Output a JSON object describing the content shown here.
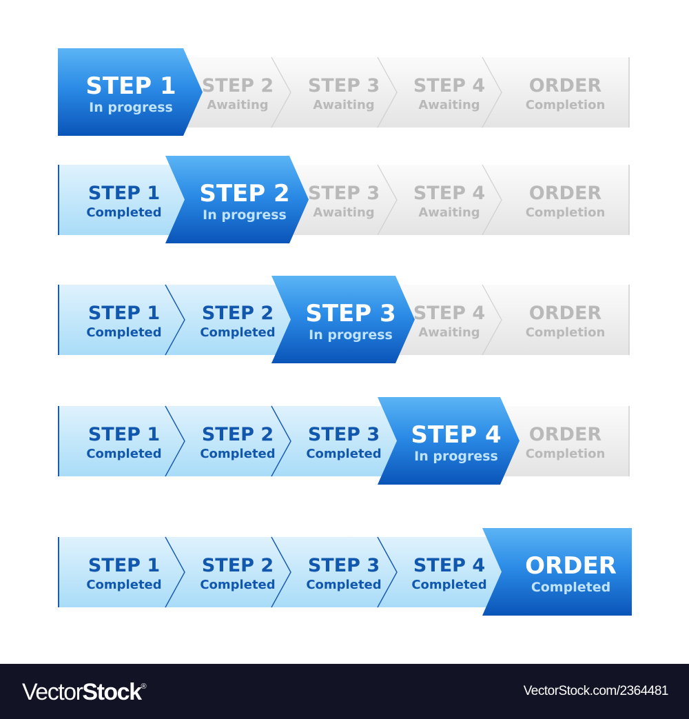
{
  "colors": {
    "active_top": "#5bb4f4",
    "active_mid": "#2b8be6",
    "active_bottom": "#0a54b8",
    "active_title": "#ffffff",
    "active_sub": "#bfe3fb",
    "done_top": "#dff2fd",
    "done_bottom": "#a9dcf8",
    "done_text": "#1057ad",
    "done_line": "#1a5cb0",
    "pending_top": "#fbfbfb",
    "pending_bottom": "#e4e4e4",
    "pending_text": "#b9b9b9",
    "pending_line": "#cfcfcf"
  },
  "rows": [
    {
      "steps": [
        {
          "title": "STEP 1",
          "status": "In progress",
          "state": "active"
        },
        {
          "title": "STEP 2",
          "status": "Awaiting",
          "state": "pending"
        },
        {
          "title": "STEP 3",
          "status": "Awaiting",
          "state": "pending"
        },
        {
          "title": "STEP 4",
          "status": "Awaiting",
          "state": "pending"
        },
        {
          "title": "ORDER",
          "status": "Completion",
          "state": "pending"
        }
      ]
    },
    {
      "steps": [
        {
          "title": "STEP 1",
          "status": "Completed",
          "state": "done"
        },
        {
          "title": "STEP 2",
          "status": "In progress",
          "state": "active"
        },
        {
          "title": "STEP 3",
          "status": "Awaiting",
          "state": "pending"
        },
        {
          "title": "STEP 4",
          "status": "Awaiting",
          "state": "pending"
        },
        {
          "title": "ORDER",
          "status": "Completion",
          "state": "pending"
        }
      ]
    },
    {
      "steps": [
        {
          "title": "STEP 1",
          "status": "Completed",
          "state": "done"
        },
        {
          "title": "STEP 2",
          "status": "Completed",
          "state": "done"
        },
        {
          "title": "STEP 3",
          "status": "In progress",
          "state": "active"
        },
        {
          "title": "STEP 4",
          "status": "Awaiting",
          "state": "pending"
        },
        {
          "title": "ORDER",
          "status": "Completion",
          "state": "pending"
        }
      ]
    },
    {
      "steps": [
        {
          "title": "STEP 1",
          "status": "Completed",
          "state": "done"
        },
        {
          "title": "STEP 2",
          "status": "Completed",
          "state": "done"
        },
        {
          "title": "STEP 3",
          "status": "Completed",
          "state": "done"
        },
        {
          "title": "STEP 4",
          "status": "In progress",
          "state": "active"
        },
        {
          "title": "ORDER",
          "status": "Completion",
          "state": "pending"
        }
      ]
    },
    {
      "steps": [
        {
          "title": "STEP 1",
          "status": "Completed",
          "state": "done"
        },
        {
          "title": "STEP 2",
          "status": "Completed",
          "state": "done"
        },
        {
          "title": "STEP 3",
          "status": "Completed",
          "state": "done"
        },
        {
          "title": "STEP 4",
          "status": "Completed",
          "state": "done"
        },
        {
          "title": "ORDER",
          "status": "Completed",
          "state": "active"
        }
      ]
    }
  ],
  "footer": {
    "brand_light": "Vector",
    "brand_bold": "Stock",
    "brand_mark": "®",
    "reference": "VectorStock.com/2364481"
  }
}
